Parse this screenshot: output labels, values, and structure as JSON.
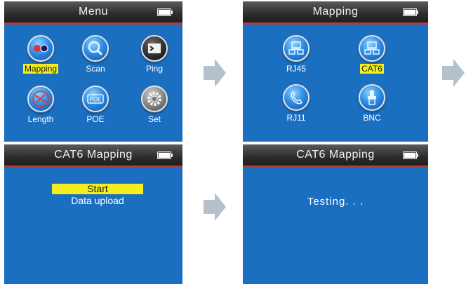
{
  "screens": {
    "menu": {
      "title": "Menu",
      "items": [
        {
          "label": "Mapping",
          "icon": "mapping-icon",
          "selected": true
        },
        {
          "label": "Scan",
          "icon": "magnifier-icon",
          "selected": false
        },
        {
          "label": "Ping",
          "icon": "terminal-icon",
          "selected": false
        },
        {
          "label": "Length",
          "icon": "globe-icon",
          "selected": false
        },
        {
          "label": "POE",
          "icon": "poe-icon",
          "selected": false
        },
        {
          "label": "Set",
          "icon": "gear-icon",
          "selected": false
        }
      ]
    },
    "mapping": {
      "title": "Mapping",
      "items": [
        {
          "label": "RJ45",
          "icon": "network-icon",
          "selected": false
        },
        {
          "label": "CAT6",
          "icon": "network-icon",
          "selected": true
        },
        {
          "label": "RJ11",
          "icon": "phone-icon",
          "selected": false
        },
        {
          "label": "BNC",
          "icon": "bnc-connector-icon",
          "selected": false
        }
      ]
    },
    "cat6_menu": {
      "title": "CAT6  Mapping",
      "options": [
        {
          "label": "Start",
          "selected": true
        },
        {
          "label": "Data upload",
          "selected": false
        }
      ]
    },
    "cat6_testing": {
      "title": "CAT6  Mapping",
      "status": "Testing. . ."
    }
  },
  "colors": {
    "screen_bg": "#1b6fc1",
    "highlight": "#f4ef1c",
    "titlebar_accent": "#b23b3b",
    "arrow": "#b4c0cc"
  }
}
